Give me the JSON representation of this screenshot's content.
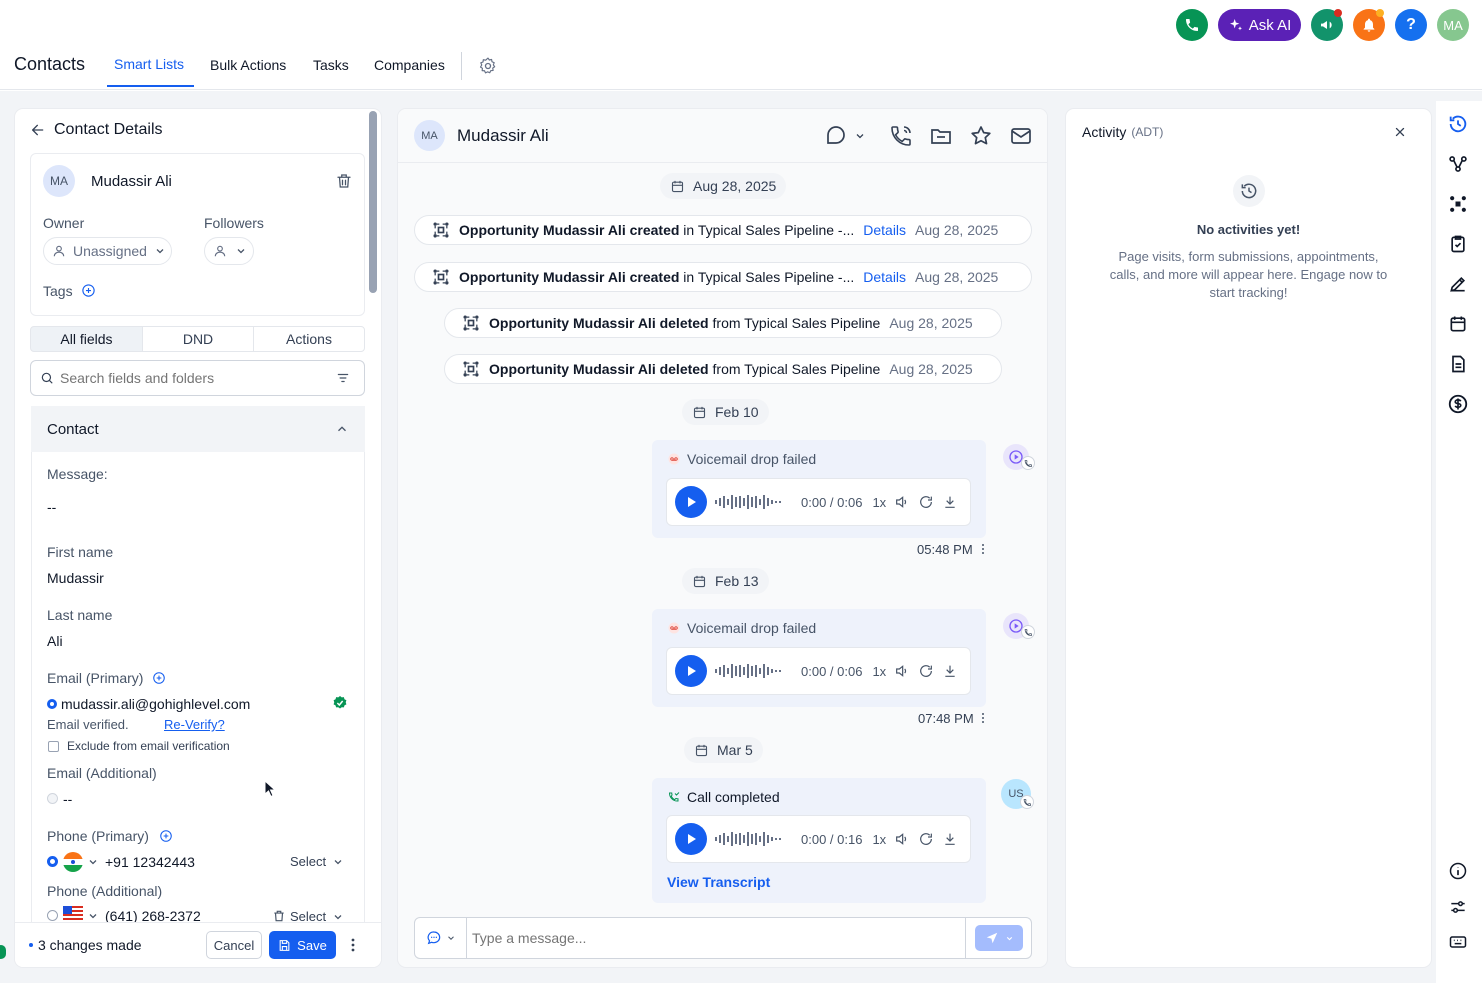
{
  "header": {
    "ask_ai": "Ask AI",
    "avatar": "MA",
    "help": "?"
  },
  "nav": {
    "title": "Contacts",
    "tabs": [
      "Smart Lists",
      "Bulk Actions",
      "Tasks",
      "Companies"
    ]
  },
  "contact_panel": {
    "back_label": "Contact Details",
    "avatar": "MA",
    "name": "Mudassir Ali",
    "owner_label": "Owner",
    "owner_value": "Unassigned",
    "followers_label": "Followers",
    "tags_label": "Tags",
    "tabs": [
      "All fields",
      "DND",
      "Actions"
    ],
    "search_placeholder": "Search fields and folders",
    "section_title": "Contact",
    "fields": {
      "message_label": "Message:",
      "message_value": "--",
      "first_name_label": "First name",
      "first_name_value": "Mudassir",
      "last_name_label": "Last name",
      "last_name_value": "Ali",
      "email_primary_label": "Email (Primary)",
      "email_primary_value": "mudassir.ali@gohighlevel.com",
      "email_verified": "Email verified.",
      "reverify": "Re-Verify?",
      "exclude_label": "Exclude from email verification",
      "email_additional_label": "Email (Additional)",
      "email_additional_value": "--",
      "phone_primary_label": "Phone (Primary)",
      "phone_primary_value": "+91 12342443",
      "phone_primary_select": "Select",
      "phone_additional_label": "Phone (Additional)",
      "phone_additional_value": "(641) 268-2372",
      "phone_additional_select": "Select"
    },
    "footer": {
      "changes": "3 changes made",
      "cancel": "Cancel",
      "save": "Save"
    }
  },
  "conversation": {
    "avatar": "MA",
    "name": "Mudassir Ali",
    "dates": [
      "Aug 28, 2025",
      "Feb 10",
      "Feb 13",
      "Mar 5"
    ],
    "events": [
      {
        "bold": "Opportunity Mudassir Ali created",
        "rest": " in Typical Sales Pipeline -...",
        "link": "Details",
        "date": "Aug 28, 2025"
      },
      {
        "bold": "Opportunity Mudassir Ali created",
        "rest": " in Typical Sales Pipeline -...",
        "link": "Details",
        "date": "Aug 28, 2025"
      },
      {
        "bold": "Opportunity Mudassir Ali deleted",
        "rest": " from Typical Sales Pipeline",
        "date": "Aug 28, 2025"
      },
      {
        "bold": "Opportunity Mudassir Ali deleted",
        "rest": " from Typical Sales Pipeline",
        "date": "Aug 28, 2025"
      }
    ],
    "messages": [
      {
        "title": "Voicemail drop failed",
        "time_progress": "0:00 / 0:06",
        "speed": "1x",
        "timestamp": "05:48 PM"
      },
      {
        "title": "Voicemail drop failed",
        "time_progress": "0:00 / 0:06",
        "speed": "1x",
        "timestamp": "07:48 PM"
      },
      {
        "title": "Call completed",
        "time_progress": "0:00 / 0:16",
        "speed": "1x",
        "link": "View Transcript",
        "avatar": "US"
      }
    ],
    "composer_placeholder": "Type a message..."
  },
  "activity": {
    "title": "Activity",
    "subtitle": "(ADT)",
    "empty_title": "No activities yet!",
    "empty_text": "Page visits, form submissions, appointments, calls, and more will appear here. Engage now to start tracking!"
  },
  "colors": {
    "primary": "#155eef",
    "green": "#079455",
    "purple": "#5b21b6",
    "orange": "#f97316",
    "red": "#d92d20"
  }
}
